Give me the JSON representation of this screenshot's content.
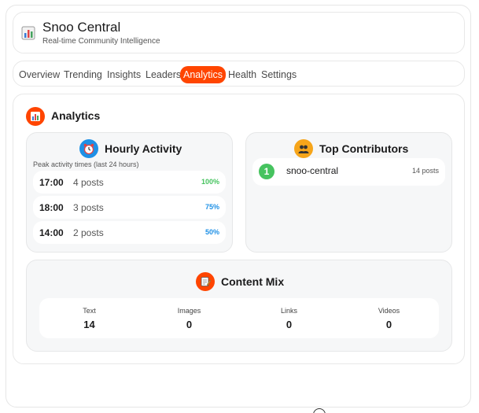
{
  "app": {
    "title": "Snoo Central",
    "subtitle": "Real-time Community Intelligence",
    "logo_icon": "bar-chart-icon"
  },
  "tabs": [
    {
      "label": "Overview",
      "active": false
    },
    {
      "label": "Trending",
      "active": false
    },
    {
      "label": "Insights",
      "active": false
    },
    {
      "label": "Leaders",
      "active": false
    },
    {
      "label": "Analytics",
      "active": true
    },
    {
      "label": "Health",
      "active": false
    },
    {
      "label": "Settings",
      "active": false
    }
  ],
  "colors": {
    "accent": "#ff4500",
    "blue": "#1e90e6",
    "gold": "#f6a51a",
    "green": "#46c35f",
    "pct_high": "#46c35f",
    "pct_mid": "#1e90e6"
  },
  "analytics": {
    "title": "Analytics",
    "icon": "bar-chart-icon",
    "hourly": {
      "title": "Hourly Activity",
      "icon": "alarm-clock-icon",
      "caption": "Peak activity times (last 24 hours)",
      "rows": [
        {
          "time": "17:00",
          "count": "4 posts",
          "pct": "100%"
        },
        {
          "time": "18:00",
          "count": "3 posts",
          "pct": "75%"
        },
        {
          "time": "14:00",
          "count": "2 posts",
          "pct": "50%"
        }
      ]
    },
    "contributors": {
      "title": "Top Contributors",
      "icon": "people-icon",
      "rows": [
        {
          "rank": "1",
          "name": "snoo-central",
          "posts": "14 posts"
        }
      ]
    },
    "content_mix": {
      "title": "Content Mix",
      "icon": "memo-icon",
      "items": [
        {
          "label": "Text",
          "value": "14"
        },
        {
          "label": "Images",
          "value": "0"
        },
        {
          "label": "Links",
          "value": "0"
        },
        {
          "label": "Videos",
          "value": "0"
        }
      ]
    }
  }
}
